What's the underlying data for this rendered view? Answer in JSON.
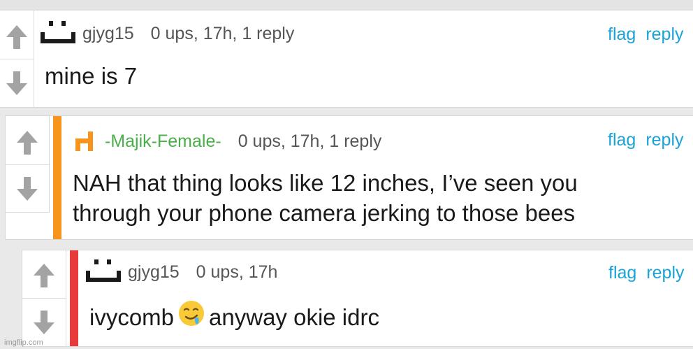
{
  "comments": [
    {
      "username": "gjyg15",
      "stats": "0 ups, 17h, 1 reply",
      "actions": {
        "flag": "flag",
        "reply": "reply"
      },
      "lines": [
        "mine is 7"
      ]
    },
    {
      "username": "-Majik-Female-",
      "stats": "0 ups, 17h, 1 reply",
      "actions": {
        "flag": "flag",
        "reply": "reply"
      },
      "lines": [
        "NAH that thing looks like 12 inches, I’ve seen you",
        "through your phone camera jerking to those bees"
      ]
    },
    {
      "username": "gjyg15",
      "stats": "0 ups, 17h",
      "actions": {
        "flag": "flag",
        "reply": "reply"
      },
      "text_before": "ivycomb",
      "text_after": "anyway okie idrc",
      "emoji": "drooling-face-emoji"
    }
  ],
  "colors": {
    "orange": "#f7941d",
    "red": "#e83a3a",
    "green": "#4aae4a",
    "link": "#1aa3d6"
  },
  "icons": [
    "upvote-arrow-icon",
    "downvote-arrow-icon",
    "user-avatar-icon"
  ],
  "watermark": "imgflip.com"
}
